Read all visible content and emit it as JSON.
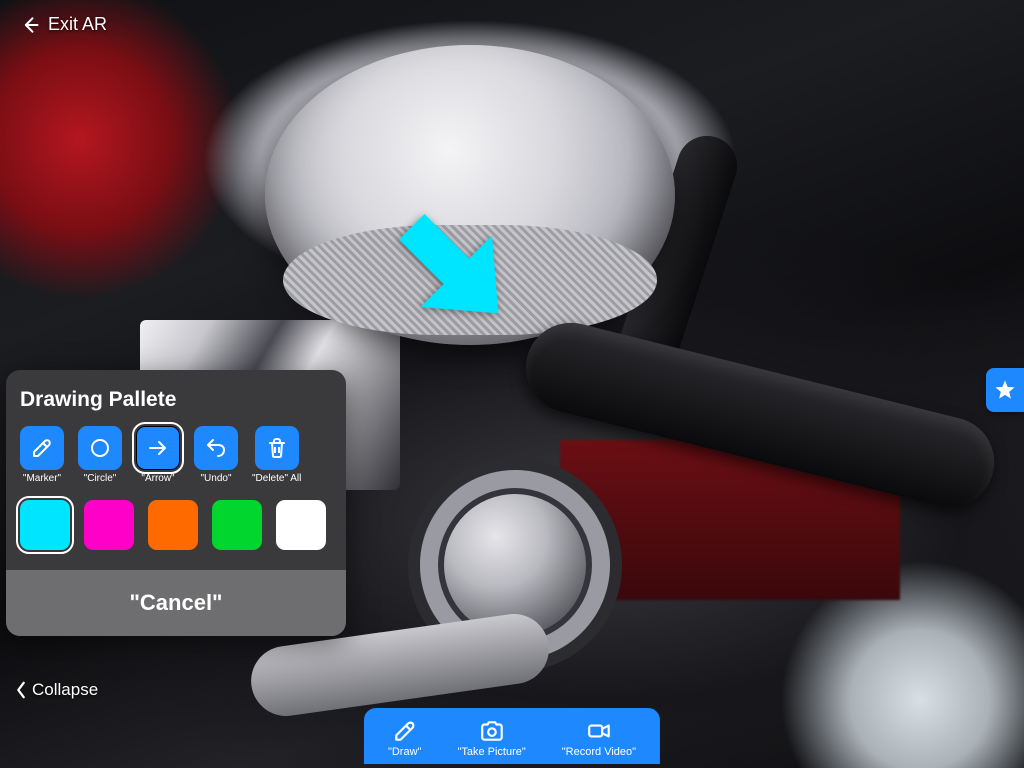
{
  "header": {
    "exit_label": "Exit AR"
  },
  "annotation": {
    "arrow_color": "#00e5ff"
  },
  "palette": {
    "title": "Drawing Pallete",
    "tools": [
      {
        "id": "marker",
        "label": "\"Marker\"",
        "selected": false
      },
      {
        "id": "circle",
        "label": "\"Circle\"",
        "selected": false
      },
      {
        "id": "arrow",
        "label": "\"Arrow\"",
        "selected": true
      },
      {
        "id": "undo",
        "label": "\"Undo\"",
        "selected": false
      },
      {
        "id": "delete",
        "label": "\"Delete\" All",
        "selected": false
      }
    ],
    "colors": [
      {
        "id": "cyan",
        "hex": "#00e5ff",
        "selected": true
      },
      {
        "id": "magenta",
        "hex": "#ff00c8",
        "selected": false
      },
      {
        "id": "orange",
        "hex": "#ff6a00",
        "selected": false
      },
      {
        "id": "green",
        "hex": "#00d62e",
        "selected": false
      },
      {
        "id": "white",
        "hex": "#ffffff",
        "selected": false
      }
    ],
    "cancel_label": "\"Cancel\""
  },
  "collapse_label": "Collapse",
  "bottom_bar": {
    "items": [
      {
        "id": "draw",
        "label": "\"Draw\""
      },
      {
        "id": "picture",
        "label": "\"Take Picture\""
      },
      {
        "id": "video",
        "label": "\"Record Video\""
      }
    ]
  },
  "accent": "#1e88ff"
}
